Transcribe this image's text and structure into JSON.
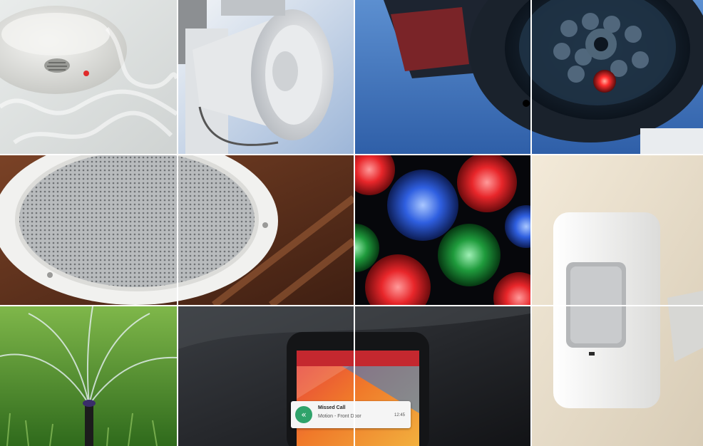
{
  "collage": {
    "tiles": [
      {
        "name": "smoke-detector-tile",
        "subject": "smoke-detector-icon"
      },
      {
        "name": "horn-speaker-tile",
        "subject": "horn-speaker-icon"
      },
      {
        "name": "security-camera-tile",
        "subject": "security-camera-icon"
      },
      {
        "name": "ceiling-speaker-tile",
        "subject": "ceiling-speaker-icon"
      },
      {
        "name": "party-lights-tile",
        "subject": "led-light-icon"
      },
      {
        "name": "motion-sensor-tile",
        "subject": "motion-sensor-icon"
      },
      {
        "name": "lawn-sprinkler-tile",
        "subject": "sprinkler-icon"
      },
      {
        "name": "smartphone-tile",
        "subject": "smartphone-icon"
      }
    ],
    "phone_notification": {
      "title": "Missed Call",
      "subtitle": "Motion - Front Door",
      "time": "12:45"
    },
    "colors": {
      "grid_line": "#ffffff",
      "camera_sky": "#3f6fb3",
      "led_red": "#e8262a",
      "led_blue": "#2f5fe0",
      "led_green": "#1f9b3c",
      "grass": "#4f8f2a",
      "wood": "#5a2e1a"
    }
  }
}
